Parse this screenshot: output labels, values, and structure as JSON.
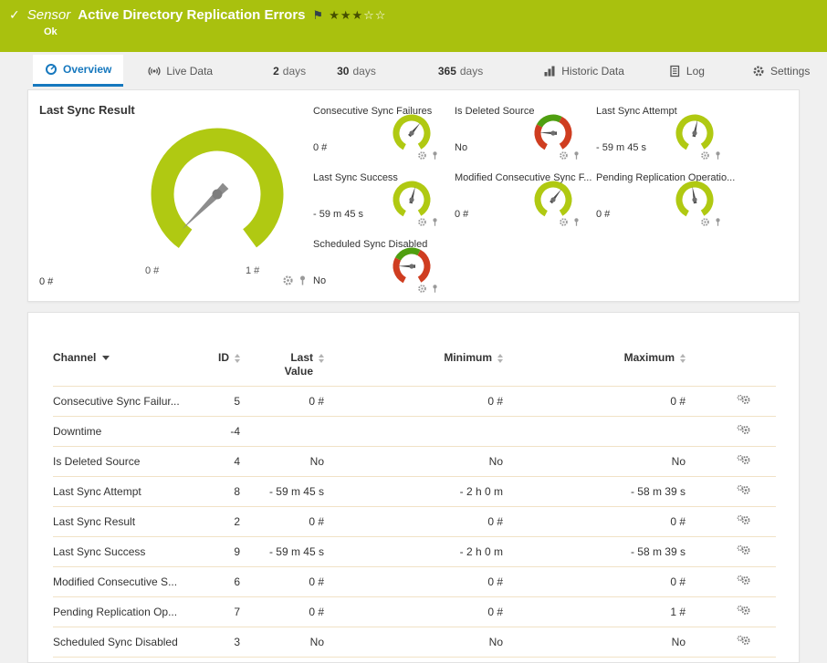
{
  "header": {
    "check": "✓",
    "kind": "Sensor",
    "title": "Active Directory Replication Errors",
    "flag": "⚑",
    "stars_filled": "★★★",
    "stars_empty": "☆☆",
    "status": "Ok"
  },
  "tabs": {
    "overview": "Overview",
    "live_data": "Live Data",
    "d2_num": "2",
    "d2_label": "days",
    "d30_num": "30",
    "d30_label": "days",
    "d365_num": "365",
    "d365_label": "days",
    "historic": "Historic Data",
    "log": "Log",
    "settings": "Settings"
  },
  "gauges": {
    "primary": {
      "title": "Last Sync Result",
      "value": "0 #",
      "min": "0 #",
      "max": "1 #"
    },
    "small": [
      {
        "title": "Consecutive Sync Failures",
        "value": "0 #",
        "type": "lime"
      },
      {
        "title": "Is Deleted Source",
        "value": "No",
        "type": "bool"
      },
      {
        "title": "Last Sync Attempt",
        "value": "- 59 m 45 s",
        "type": "lime"
      },
      {
        "title": "Last Sync Success",
        "value": "- 59 m 45 s",
        "type": "lime"
      },
      {
        "title": "Modified Consecutive Sync F...",
        "value": "0 #",
        "type": "lime"
      },
      {
        "title": "Pending Replication Operatio...",
        "value": "0 #",
        "type": "lime"
      },
      {
        "title": "Scheduled Sync Disabled",
        "value": "No",
        "type": "bool"
      }
    ]
  },
  "table": {
    "headers": {
      "channel": "Channel",
      "id": "ID",
      "last": "Last Value",
      "min": "Minimum",
      "max": "Maximum"
    },
    "rows": [
      {
        "channel": "Consecutive Sync Failur...",
        "id": "5",
        "last": "0 #",
        "min": "0 #",
        "max": "0 #"
      },
      {
        "channel": "Downtime",
        "id": "-4",
        "last": "",
        "min": "",
        "max": ""
      },
      {
        "channel": "Is Deleted Source",
        "id": "4",
        "last": "No",
        "min": "No",
        "max": "No"
      },
      {
        "channel": "Last Sync Attempt",
        "id": "8",
        "last": "- 59 m 45 s",
        "min": "- 2 h 0 m",
        "max": "- 58 m 39 s"
      },
      {
        "channel": "Last Sync Result",
        "id": "2",
        "last": "0 #",
        "min": "0 #",
        "max": "0 #"
      },
      {
        "channel": "Last Sync Success",
        "id": "9",
        "last": "- 59 m 45 s",
        "min": "- 2 h 0 m",
        "max": "- 58 m 39 s"
      },
      {
        "channel": "Modified Consecutive S...",
        "id": "6",
        "last": "0 #",
        "min": "0 #",
        "max": "0 #"
      },
      {
        "channel": "Pending Replication Op...",
        "id": "7",
        "last": "0 #",
        "min": "0 #",
        "max": "1 #"
      },
      {
        "channel": "Scheduled Sync Disabled",
        "id": "3",
        "last": "No",
        "min": "No",
        "max": "No"
      }
    ]
  },
  "colors": {
    "brand_green": "#a9c10e",
    "gauge_lime": "#b0c912",
    "gauge_red": "#cf3d20",
    "gauge_ok_green": "#4f9f10",
    "accent_blue": "#1678be",
    "row_divider": "#f1e2c6"
  }
}
